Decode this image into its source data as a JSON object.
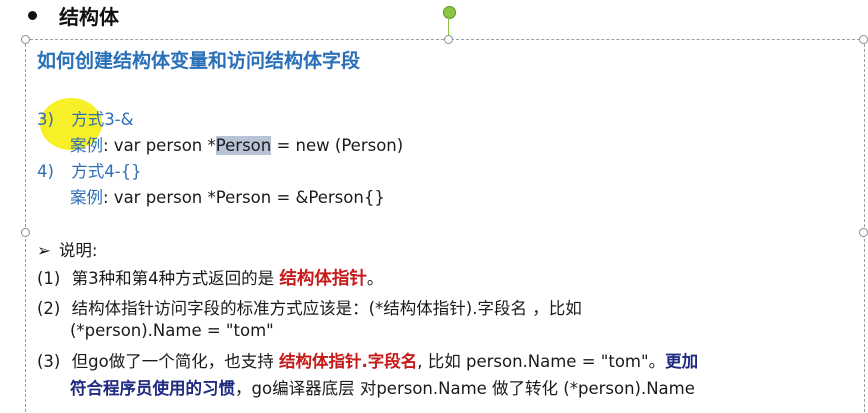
{
  "title": "结构体",
  "subheading": "如何创建结构体变量和访问结构体字段",
  "method3": {
    "num": "3)",
    "label": "方式3-&",
    "case_label": "案例",
    "code_pre": ": var person *",
    "code_sel": "Person",
    "code_post": " = new (Person)"
  },
  "method4": {
    "num": "4)",
    "label": "方式4-{}",
    "case_label": "案例",
    "code": ": var person *Person = &Person{}"
  },
  "notes_title": "说明:",
  "note1": {
    "num": "(1)",
    "pre": "第3种和第4种方式返回的是 ",
    "em": "结构体指针",
    "post": "。"
  },
  "note2": {
    "num": "(2)",
    "line1": "结构体指针访问字段的标准方式应该是：(*结构体指针).字段名 ，比如",
    "line2": "(*person).Name = \"tom\""
  },
  "note3": {
    "num": "(3)",
    "pre": "但go做了一个简化，也支持 ",
    "em": "结构体指针.字段名",
    "mid": ", 比如 person.Name = \"tom\"。",
    "em2a": "更加",
    "em2b": "符合程序员使用的习惯",
    "post": "，go编译器底层 对person.Name 做了转化 (*person).Name"
  }
}
